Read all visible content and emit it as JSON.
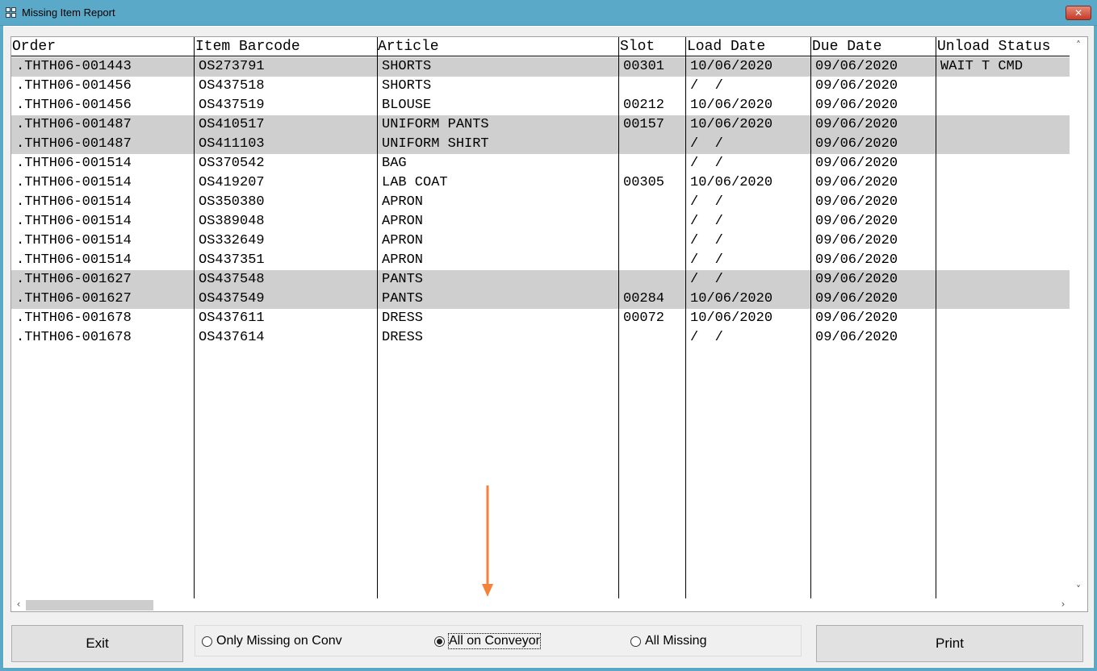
{
  "window": {
    "title": "Missing Item Report",
    "close_glyph": "✕"
  },
  "grid": {
    "columns": [
      "Order",
      "Item Barcode",
      "Article",
      "Slot",
      "Load Date",
      "Due Date",
      "Unload Status"
    ],
    "rows": [
      {
        "order": ".THTH06-001443",
        "barcode": "OS273791",
        "article": "SHORTS",
        "slot": "00301",
        "load": "10/06/2020",
        "due": "09/06/2020",
        "status": "WAIT T CMD",
        "selected": true
      },
      {
        "order": ".THTH06-001456",
        "barcode": "OS437518",
        "article": "SHORTS",
        "slot": "",
        "load": "/  /",
        "due": "09/06/2020",
        "status": "",
        "selected": false
      },
      {
        "order": ".THTH06-001456",
        "barcode": "OS437519",
        "article": "BLOUSE",
        "slot": "00212",
        "load": "10/06/2020",
        "due": "09/06/2020",
        "status": "",
        "selected": false
      },
      {
        "order": ".THTH06-001487",
        "barcode": "OS410517",
        "article": "UNIFORM PANTS",
        "slot": "00157",
        "load": "10/06/2020",
        "due": "09/06/2020",
        "status": "",
        "selected": true
      },
      {
        "order": ".THTH06-001487",
        "barcode": "OS411103",
        "article": "UNIFORM SHIRT",
        "slot": "",
        "load": "/  /",
        "due": "09/06/2020",
        "status": "",
        "selected": true
      },
      {
        "order": ".THTH06-001514",
        "barcode": "OS370542",
        "article": "BAG",
        "slot": "",
        "load": "/  /",
        "due": "09/06/2020",
        "status": "",
        "selected": false
      },
      {
        "order": ".THTH06-001514",
        "barcode": "OS419207",
        "article": "LAB COAT",
        "slot": "00305",
        "load": "10/06/2020",
        "due": "09/06/2020",
        "status": "",
        "selected": false
      },
      {
        "order": ".THTH06-001514",
        "barcode": "OS350380",
        "article": "APRON",
        "slot": "",
        "load": "/  /",
        "due": "09/06/2020",
        "status": "",
        "selected": false
      },
      {
        "order": ".THTH06-001514",
        "barcode": "OS389048",
        "article": "APRON",
        "slot": "",
        "load": "/  /",
        "due": "09/06/2020",
        "status": "",
        "selected": false
      },
      {
        "order": ".THTH06-001514",
        "barcode": "OS332649",
        "article": "APRON",
        "slot": "",
        "load": "/  /",
        "due": "09/06/2020",
        "status": "",
        "selected": false
      },
      {
        "order": ".THTH06-001514",
        "barcode": "OS437351",
        "article": "APRON",
        "slot": "",
        "load": "/  /",
        "due": "09/06/2020",
        "status": "",
        "selected": false
      },
      {
        "order": ".THTH06-001627",
        "barcode": "OS437548",
        "article": "PANTS",
        "slot": "",
        "load": "/  /",
        "due": "09/06/2020",
        "status": "",
        "selected": true
      },
      {
        "order": ".THTH06-001627",
        "barcode": "OS437549",
        "article": "PANTS",
        "slot": "00284",
        "load": "10/06/2020",
        "due": "09/06/2020",
        "status": "",
        "selected": true
      },
      {
        "order": ".THTH06-001678",
        "barcode": "OS437611",
        "article": "DRESS",
        "slot": "00072",
        "load": "10/06/2020",
        "due": "09/06/2020",
        "status": "",
        "selected": false
      },
      {
        "order": ".THTH06-001678",
        "barcode": "OS437614",
        "article": "DRESS",
        "slot": "",
        "load": "/  /",
        "due": "09/06/2020",
        "status": "",
        "selected": false
      }
    ],
    "scroll_up_glyph": "˄",
    "scroll_down_glyph": "˅",
    "scroll_left_glyph": "‹",
    "scroll_right_glyph": "›"
  },
  "footer": {
    "exit_label": "Exit",
    "print_label": "Print",
    "filter_options": [
      {
        "label": "Only Missing on Conv",
        "checked": false
      },
      {
        "label": "All on Conveyor",
        "checked": true
      },
      {
        "label": "All Missing",
        "checked": false
      }
    ]
  },
  "annotation": {
    "arrow_color": "#f5823a"
  }
}
